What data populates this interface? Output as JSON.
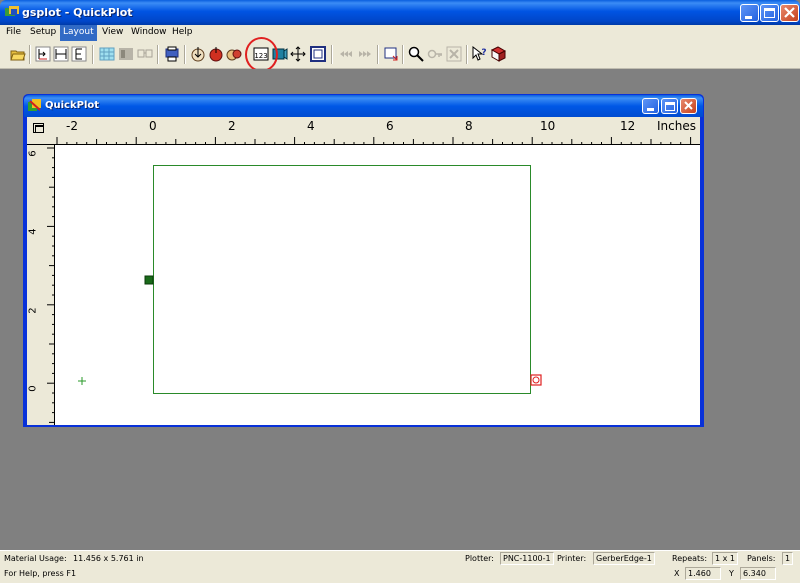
{
  "app": {
    "title": "gsplot - QuickPlot"
  },
  "menu": {
    "items": [
      "File",
      "Setup",
      "Layout",
      "View",
      "Window",
      "Help"
    ],
    "active": "Layout"
  },
  "child_window": {
    "title": "QuickPlot",
    "ruler_h_labels": [
      "-2",
      "0",
      "2",
      "4",
      "6",
      "8",
      "10",
      "12"
    ],
    "ruler_units": "Inches",
    "ruler_v_labels": [
      "6",
      "4",
      "2",
      "0"
    ]
  },
  "status": {
    "material_label": "Material Usage:",
    "material_value": "11.456 x 5.761 in",
    "plotter_label": "Plotter:",
    "plotter_value": "PNC-1100-1",
    "printer_label": "Printer:",
    "printer_value": "GerberEdge-1",
    "repeats_label": "Repeats:",
    "repeats_value": "1 x 1",
    "panels_label": "Panels:",
    "panels_value": "1",
    "help_text": "For Help, press F1",
    "x_label": "X",
    "x_value": "1.460",
    "y_label": "Y",
    "y_value": "6.340"
  },
  "colors": {
    "accent_active_menu": "#316ac5",
    "material_rect": "#2a8a2a",
    "highlight_ring": "#e02020"
  }
}
